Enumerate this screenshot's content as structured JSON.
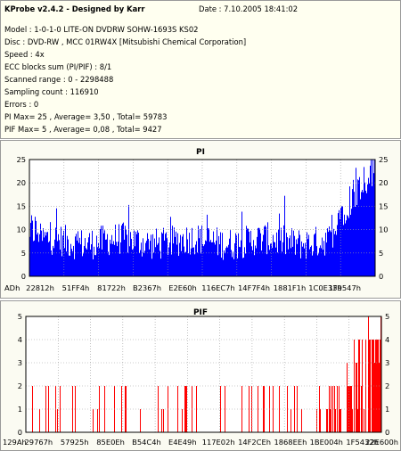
{
  "header": {
    "title": "KProbe v2.4.2 - Designed by Karr",
    "date": "Date : 7.10.2005 18:41:02",
    "lines": [
      "Model : 1-0-1-0 LITE-ON DVDRW SOHW-1693S KS02",
      "Disc : DVD-RW , MCC 01RW4X  [Mitsubishi Chemical Corporation]",
      "Speed : 4x",
      "ECC blocks sum (PI/PIF) : 8/1",
      "Scanned range : 0 - 2298488",
      "Sampling count : 116910",
      "Errors : 0",
      "PI Max= 25 , Average= 3,50 , Total= 59783",
      "PIF Max= 5 , Average= 0,08 , Total= 9427"
    ]
  },
  "charts": {
    "pi": {
      "title": "PI",
      "color": "#0000ff",
      "y_ticks": [
        "0",
        "5",
        "10",
        "15",
        "20",
        "25"
      ],
      "x_ticks": [
        "ADh",
        "22812h",
        "51FF4h",
        "81722h",
        "B2367h",
        "E2E60h",
        "116EC7h",
        "14F7F4h",
        "1881F1h",
        "1C0E33h",
        "1F9547h"
      ]
    },
    "pif": {
      "title": "PIF",
      "color": "#ff0000",
      "y_ticks": [
        "0",
        "1",
        "2",
        "3",
        "4",
        "5"
      ],
      "x_ticks": [
        "129Ah",
        "29767h",
        "57925h",
        "85E0Eh",
        "B54C4h",
        "E4E49h",
        "117E02h",
        "14F2CEh",
        "1868EEh",
        "1BE004h",
        "1F5432h",
        "22E600h"
      ]
    }
  },
  "chart_data": [
    {
      "type": "bar",
      "title": "PI",
      "ylim": [
        0,
        25
      ],
      "grid": true,
      "categories": [
        "ADh",
        "22812h",
        "51FF4h",
        "81722h",
        "B2367h",
        "E2E60h",
        "116EC7h",
        "14F7F4h",
        "1881F1h",
        "1C0E33h",
        "1F9547h"
      ],
      "series": [
        {
          "values": [
            5,
            6,
            6,
            5,
            5,
            5,
            5,
            5,
            5,
            6,
            15,
            25
          ]
        }
      ]
    },
    {
      "type": "bar",
      "title": "PIF",
      "ylim": [
        0,
        5
      ],
      "grid": true,
      "categories": [
        "129Ah",
        "29767h",
        "57925h",
        "85E0Eh",
        "B54C4h",
        "E4E49h",
        "117E02h",
        "14F2CEh",
        "1868EEh",
        "1BE004h",
        "1F5432h",
        "22E600h"
      ],
      "series": [
        {
          "values": [
            2,
            2,
            2,
            2,
            2,
            2,
            2,
            2,
            2,
            2,
            3,
            5
          ]
        }
      ]
    }
  ]
}
